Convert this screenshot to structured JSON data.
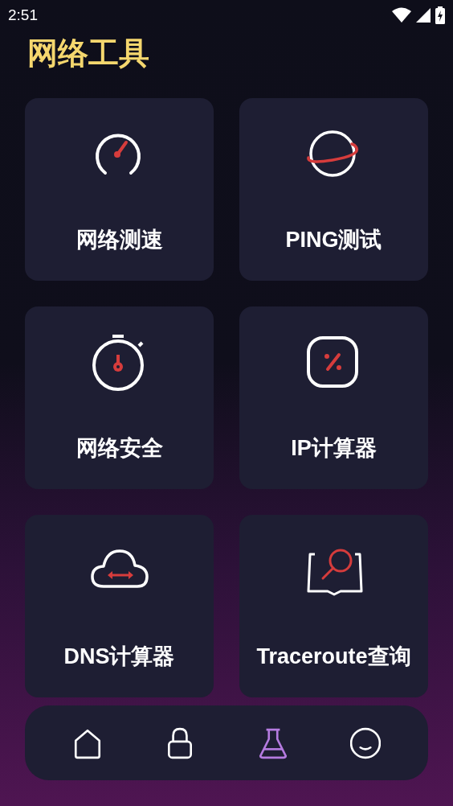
{
  "status_bar": {
    "time": "2:51"
  },
  "title": "网络工具",
  "tools": [
    {
      "kind": "speedometer",
      "label": "网络测速"
    },
    {
      "kind": "planet",
      "label": "PING测试"
    },
    {
      "kind": "stopwatch",
      "label": "网络安全"
    },
    {
      "kind": "percent",
      "label": "IP计算器"
    },
    {
      "kind": "cloud",
      "label": "DNS计算器"
    },
    {
      "kind": "book",
      "label": "Traceroute查询"
    }
  ],
  "nav": [
    {
      "kind": "home",
      "selected": false
    },
    {
      "kind": "lock",
      "selected": false
    },
    {
      "kind": "flask",
      "selected": true
    },
    {
      "kind": "smile",
      "selected": false
    }
  ]
}
